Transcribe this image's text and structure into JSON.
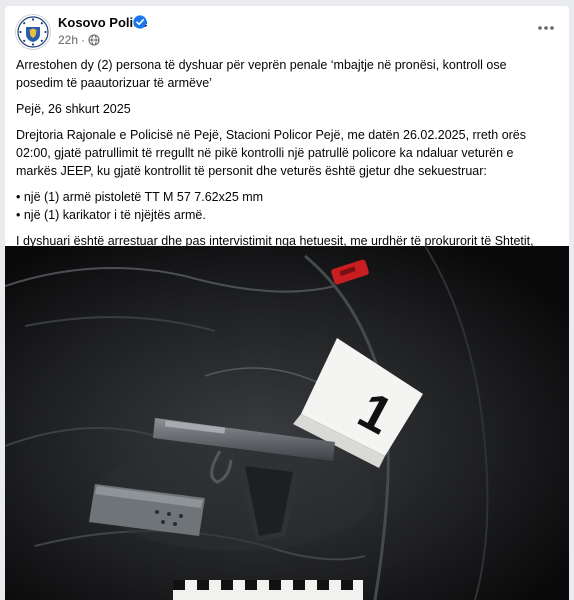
{
  "post": {
    "page_name": "Kosovo Police",
    "time": "22h",
    "dot": "·",
    "paragraphs": {
      "p1": "Arrestohen dy (2) persona të dyshuar për veprën penale ‘mbajtje në pronësi, kontroll ose posedim të paautorizuar të armëve’",
      "p2": "Pejë, 26 shkurt 2025",
      "p3": "Drejtoria Rajonale e Policisë në Pejë, Stacioni Policor Pejë, me datën 26.02.2025, rreth orës 02:00, gjatë patrullimit të rregullt në pikë kontrolli një patrullë policore ka ndaluar veturën e markës JEEP, ku gjatë kontrollit të personit dhe veturës është gjetur dhe sekuestruar:",
      "b1": "• një (1) armë pistoletë TT M 57 7.62x25 mm",
      "b2": "• një (1) karikator i të njëjtës armë.",
      "p4": "I dyshuari është arrestuar dhe pas intervistimit nga hetuesit, me urdhër të prokurorit të Shtetit, lirohet në procedurë të rregullt."
    },
    "photo": {
      "evidence_marker": "1"
    },
    "icons": {
      "verified": "verified-badge-icon",
      "privacy": "globe-icon",
      "more": "more-options-icon"
    },
    "colors": {
      "verified_blue": "#1877f2",
      "text": "#050505",
      "secondary_text": "#65676b"
    }
  }
}
